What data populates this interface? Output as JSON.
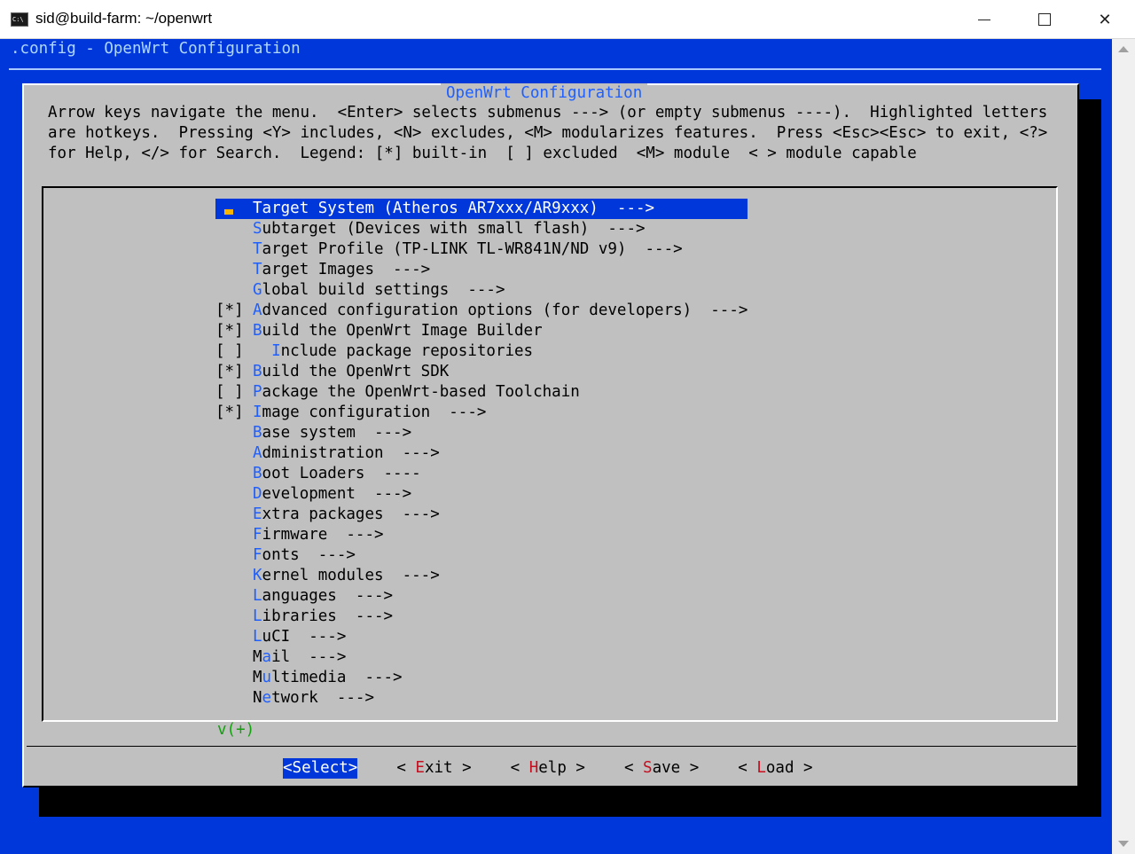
{
  "window": {
    "title": "sid@build-farm: ~/openwrt",
    "icon": "cmd-icon",
    "controls": [
      "minimize",
      "maximize",
      "close"
    ],
    "close_glyph": "✕"
  },
  "terminal": {
    "header": ".config - OpenWrt Configuration"
  },
  "dialog": {
    "title": "OpenWrt Configuration",
    "help_text": "Arrow keys navigate the menu.  <Enter> selects submenus ---> (or empty submenus ----).  Highlighted letters\nare hotkeys.  Pressing <Y> includes, <N> excludes, <M> modularizes features.  Press <Esc><Esc> to exit, <?>\nfor Help, </> for Search.  Legend: [*] built-in  [ ] excluded  <M> module  < > module capable",
    "menu_items": [
      {
        "prefix": "",
        "hotkey": "T",
        "rest": "arget System (Atheros AR7xxx/AR9xxx)  --->",
        "selected": true
      },
      {
        "prefix": "",
        "hotkey": "S",
        "rest": "ubtarget (Devices with small flash)  --->"
      },
      {
        "prefix": "",
        "hotkey": "T",
        "rest": "arget Profile (TP-LINK TL-WR841N/ND v9)  --->"
      },
      {
        "prefix": "",
        "hotkey": "T",
        "rest": "arget Images  --->"
      },
      {
        "prefix": "",
        "hotkey": "G",
        "rest": "lobal build settings  --->"
      },
      {
        "prefix": "[*]",
        "hotkey": "A",
        "rest": "dvanced configuration options (for developers)  --->"
      },
      {
        "prefix": "[*]",
        "hotkey": "B",
        "rest": "uild the OpenWrt Image Builder"
      },
      {
        "prefix": "[ ]",
        "indent": "  ",
        "hotkey": "I",
        "rest": "nclude package repositories"
      },
      {
        "prefix": "[*]",
        "hotkey": "B",
        "rest": "uild the OpenWrt SDK"
      },
      {
        "prefix": "[ ]",
        "hotkey": "P",
        "rest": "ackage the OpenWrt-based Toolchain"
      },
      {
        "prefix": "[*]",
        "hotkey": "I",
        "rest": "mage configuration  --->"
      },
      {
        "prefix": "",
        "hotkey": "B",
        "rest": "ase system  --->"
      },
      {
        "prefix": "",
        "hotkey": "A",
        "rest": "dministration  --->"
      },
      {
        "prefix": "",
        "hotkey": "B",
        "rest": "oot Loaders  ----"
      },
      {
        "prefix": "",
        "hotkey": "D",
        "rest": "evelopment  --->"
      },
      {
        "prefix": "",
        "hotkey": "E",
        "rest": "xtra packages  --->"
      },
      {
        "prefix": "",
        "hotkey": "F",
        "rest": "irmware  --->"
      },
      {
        "prefix": "",
        "hotkey": "F",
        "rest": "onts  --->"
      },
      {
        "prefix": "",
        "hotkey": "K",
        "rest": "ernel modules  --->"
      },
      {
        "prefix": "",
        "hotkey": "L",
        "rest": "anguages  --->"
      },
      {
        "prefix": "",
        "hotkey": "L",
        "rest": "ibraries  --->"
      },
      {
        "prefix": "",
        "hotkey": "L",
        "rest": "uCI  --->"
      },
      {
        "prefix": "",
        "before": "M",
        "hotkey": "a",
        "rest": "il  --->"
      },
      {
        "prefix": "",
        "before": "M",
        "hotkey": "u",
        "rest": "ltimedia  --->"
      },
      {
        "prefix": "",
        "before": "N",
        "hotkey": "e",
        "rest": "twork  --->"
      }
    ],
    "more_indicator": "v(+)",
    "buttons": [
      {
        "label": "Select",
        "hotkey": "",
        "active": true
      },
      {
        "label": "xit",
        "hotkey": "E"
      },
      {
        "label": "elp",
        "hotkey": "H"
      },
      {
        "label": "ave",
        "hotkey": "S"
      },
      {
        "label": "oad",
        "hotkey": "L"
      }
    ]
  },
  "colors": {
    "terminal_bg": "#0037da",
    "dialog_bg": "#c0c0c0",
    "hotkey_menu": "#1f5fff",
    "hotkey_button": "#c50f1f",
    "more_indicator": "#13a10e",
    "cursor": "#f7b500"
  }
}
